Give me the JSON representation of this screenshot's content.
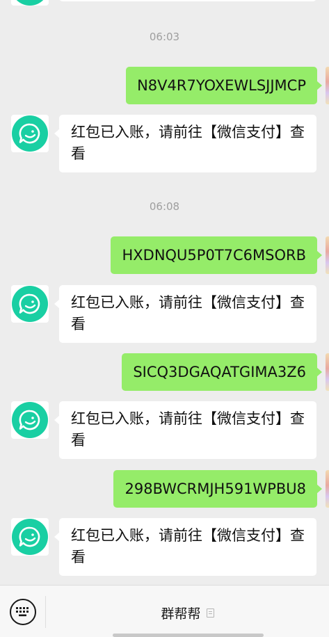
{
  "messages": {
    "t1": "06:03",
    "out1": "N8V4R7YOXEWLSJJMCP",
    "in1": "红包已入账，请前往【微信支付】查看",
    "t2": "06:08",
    "out2": "HXDNQU5P0T7C6MSORB",
    "in2": "红包已入账，请前往【微信支付】查看",
    "out3": "SICQ3DGAQATGIMA3Z6",
    "in3": "红包已入账，请前往【微信支付】查看",
    "out4": "298BWCRMJH591WPBU8",
    "in4": "红包已入账，请前往【微信支付】查看"
  },
  "footer": {
    "menu_title": "群帮帮",
    "keyboard_icon": "keyboard-icon",
    "menu_icon": "menu-list-icon"
  },
  "colors": {
    "outgoing_bubble": "#95ec69",
    "incoming_bubble": "#ffffff",
    "avatar_accent": "#19cfa3",
    "background": "#ededed"
  }
}
